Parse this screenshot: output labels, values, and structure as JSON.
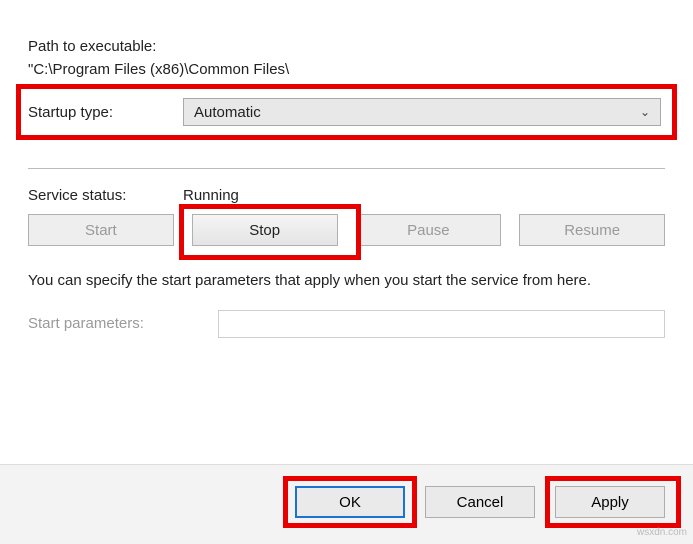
{
  "path": {
    "label": "Path to executable:",
    "value": "\"C:\\Program Files (x86)\\Common Files\\"
  },
  "startup": {
    "label": "Startup type:",
    "value": "Automatic"
  },
  "status": {
    "label": "Service status:",
    "value": "Running"
  },
  "buttons": {
    "start": "Start",
    "stop": "Stop",
    "pause": "Pause",
    "resume": "Resume"
  },
  "description": "You can specify the start parameters that apply when you start the service from here.",
  "startParams": {
    "label": "Start parameters:",
    "value": ""
  },
  "footer": {
    "ok": "OK",
    "cancel": "Cancel",
    "apply": "Apply"
  },
  "watermark": "wsxdn.com"
}
